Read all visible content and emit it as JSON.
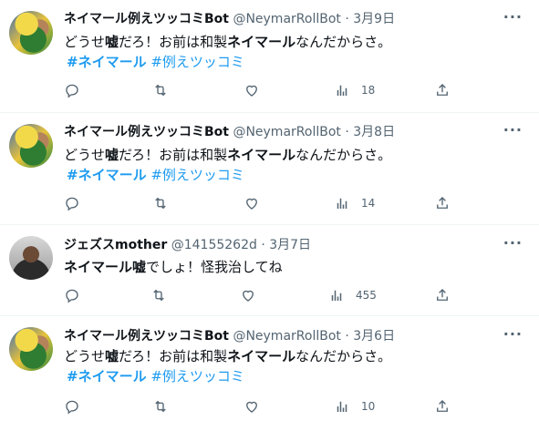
{
  "tweets": [
    {
      "avatar": "neymar-avatar",
      "name": "ネイマール例えツッコミBot",
      "handle": "@NeymarRollBot",
      "separator": "·",
      "date": "3月9日",
      "text_pre": "どうせ",
      "text_bold1": "嘘",
      "text_mid": "だろ！お前は和製",
      "text_bold2": "ネイマール",
      "text_post": "なんだからさ。",
      "tag1": "#ネイマール",
      "tag2": "#例えツッコミ",
      "views": "18"
    },
    {
      "avatar": "neymar-avatar",
      "name": "ネイマール例えツッコミBot",
      "handle": "@NeymarRollBot",
      "separator": "·",
      "date": "3月8日",
      "text_pre": "どうせ",
      "text_bold1": "嘘",
      "text_mid": "だろ！お前は和製",
      "text_bold2": "ネイマール",
      "text_post": "なんだからさ。",
      "tag1": "#ネイマール",
      "tag2": "#例えツッコミ",
      "views": "14"
    },
    {
      "avatar": "jesus-avatar",
      "name": "ジェズスmother",
      "handle": "@14155262d",
      "separator": "·",
      "date": "3月7日",
      "text_bold": "ネイマール嘘",
      "text_rest": "でしょ！怪我治してね",
      "views": "455"
    },
    {
      "avatar": "neymar-avatar",
      "name": "ネイマール例えツッコミBot",
      "handle": "@NeymarRollBot",
      "separator": "·",
      "date": "3月6日",
      "text_pre": "どうせ",
      "text_bold1": "嘘",
      "text_mid": "だろ！お前は和製",
      "text_bold2": "ネイマール",
      "text_post": "なんだからさ。",
      "tag1": "#ネイマール",
      "tag2": "#例えツッコミ",
      "views": "10"
    }
  ],
  "icons": {
    "more": "more-icon",
    "reply": "reply-icon",
    "retweet": "retweet-icon",
    "like": "like-icon",
    "views": "views-icon",
    "share": "share-icon"
  },
  "colors": {
    "link": "#1d9bf0",
    "text": "#0f1419",
    "muted": "#536471",
    "divider": "#eff3f4"
  }
}
